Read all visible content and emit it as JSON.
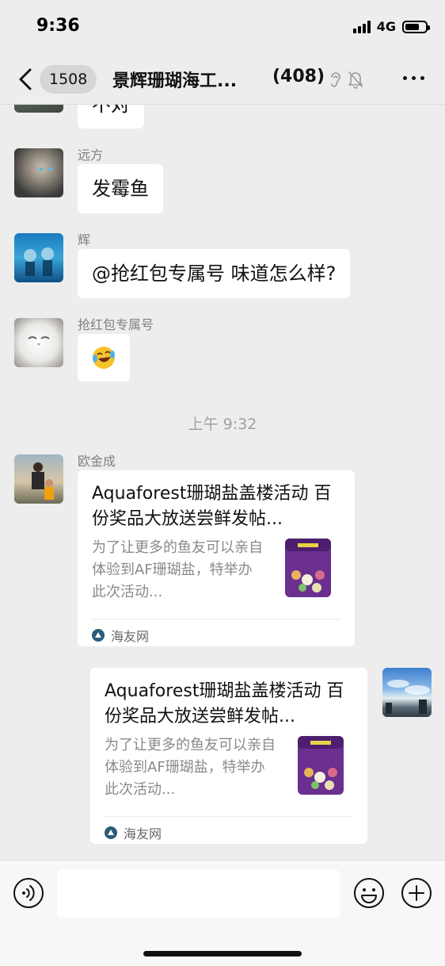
{
  "status_bar": {
    "time": "9:36",
    "network": "4G"
  },
  "nav": {
    "unread_count": "1508",
    "title": "景辉珊瑚海工...",
    "member_count": "(408)"
  },
  "messages": [
    {
      "sender": "",
      "text": "不对"
    },
    {
      "sender": "远方",
      "text": "发霉鱼"
    },
    {
      "sender": "辉",
      "text": "@抢红包专属号 味道怎么样?"
    },
    {
      "sender": "抢红包专属号",
      "text": "😂"
    }
  ],
  "timestamp": "上午 9:32",
  "link_messages": [
    {
      "sender": "欧金成",
      "title": "Aquaforest珊瑚盐盖楼活动 百份奖品大放送尝鲜发帖...",
      "desc": "为了让更多的鱼友可以亲自体验到AF珊瑚盐，特举办此次活动...",
      "source": "海友网"
    },
    {
      "sender": "",
      "title": "Aquaforest珊瑚盐盖楼活动 百份奖品大放送尝鲜发帖...",
      "desc": "为了让更多的鱼友可以亲自体验到AF珊瑚盐，特举办此次活动...",
      "source": "海友网"
    }
  ],
  "icons": {
    "back": "chevron-left-icon",
    "ear": "ear-icon",
    "mute": "bell-mute-icon",
    "more": "more-icon",
    "voice": "voice-icon",
    "emoji": "emoji-icon",
    "plus": "plus-icon"
  },
  "colors": {
    "background": "#ededed",
    "bubble": "#ffffff",
    "meta": "#808080"
  }
}
